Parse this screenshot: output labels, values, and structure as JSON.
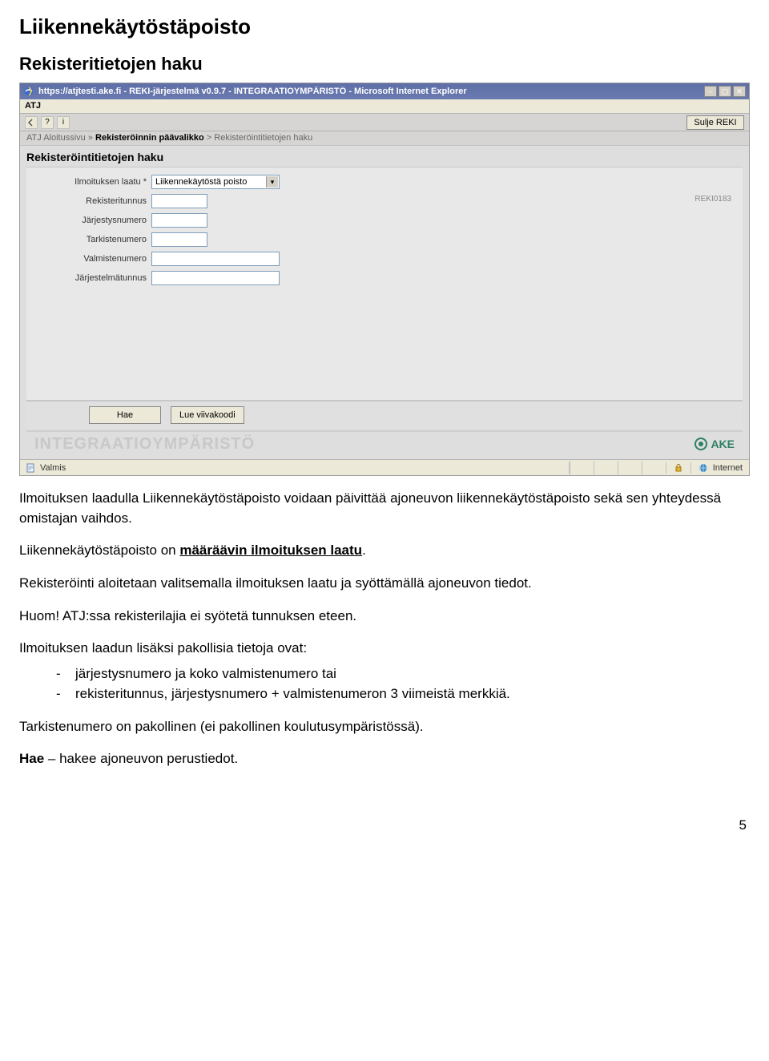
{
  "doc": {
    "h1": "Liikennekäytöstäpoisto",
    "h2": "Rekisteritietojen haku",
    "p1": "Ilmoituksen laadulla Liikennekäytöstäpoisto voidaan päivittää ajoneuvon liikennekäytöstäpoisto sekä sen yhteydessä omistajan vaihdos.",
    "p2_a": "Liikennekäytöstäpoisto on ",
    "p2_u": "määräävin ilmoituksen laatu",
    "p2_b": ".",
    "p3": "Rekisteröinti aloitetaan valitsemalla ilmoituksen laatu ja syöttämällä ajoneuvon tiedot.",
    "p4": "Huom! ATJ:ssa rekisterilajia ei syötetä tunnuksen eteen.",
    "p5": "Ilmoituksen laadun lisäksi pakollisia tietoja ovat:",
    "b1": "järjestysnumero ja koko valmistenumero tai",
    "b2": "rekisteritunnus, järjestysnumero + valmistenumeron 3 viimeistä merkkiä.",
    "p6": "Tarkistenumero on pakollinen (ei pakollinen koulutusympäristössä).",
    "p7_pref": "Hae",
    "p7_rest": " – hakee ajoneuvon perustiedot.",
    "page": "5"
  },
  "win_title": "https://atjtesti.ake.fi - REKI-järjestelmä v0.9.7 - INTEGRAATIOYMPÄRISTÖ - Microsoft Internet Explorer",
  "menu": "ATJ",
  "close_reky": "Sulje REKI",
  "crumb": {
    "a": "ATJ Aloitussivu",
    "sep": " » ",
    "b": "Rekisteröinnin päävalikko",
    "c": "Rekisteröintitietojen haku"
  },
  "page_title": "Rekisteröintitietojen haku",
  "screen_code": "REKI0183",
  "form": {
    "r1_label": "Ilmoituksen laatu *",
    "r1_value": "Liikennekäytöstä poisto",
    "r2_label": "Rekisteritunnus",
    "r3_label": "Järjestysnumero",
    "r4_label": "Tarkistenumero",
    "r5_label": "Valmistenumero",
    "r6_label": "Järjestelmätunnus"
  },
  "btn_hae": "Hae",
  "btn_viivakoodi": "Lue viivakoodi",
  "watermark": "INTEGRAATIOYMPÄRISTÖ",
  "ake": "AKE",
  "status_ready": "Valmis",
  "status_zone": "Internet"
}
